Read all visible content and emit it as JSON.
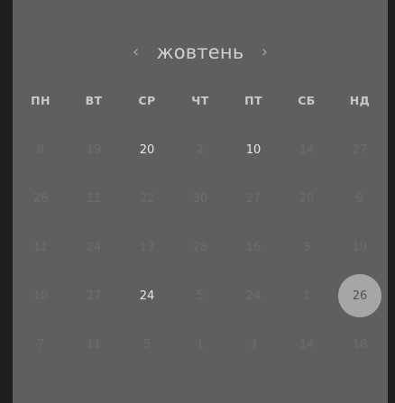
{
  "calendar": {
    "prev_icon": "‹",
    "next_icon": "›",
    "month": "жовтень",
    "weekdays": [
      "ПН",
      "ВТ",
      "СР",
      "ЧТ",
      "ПТ",
      "СБ",
      "НД"
    ],
    "weeks": [
      [
        "8",
        "19",
        "20",
        "2",
        "10",
        "14",
        "27"
      ],
      [
        "26",
        "11",
        "22",
        "30",
        "27",
        "20",
        "9"
      ],
      [
        "11",
        "24",
        "13",
        "28",
        "16",
        "3",
        "19"
      ],
      [
        "10",
        "27",
        "24",
        "5",
        "24",
        "1",
        "26"
      ],
      [
        "7",
        "11",
        "5",
        "1",
        "3",
        "14",
        "18"
      ]
    ],
    "highlighted": [
      [
        0,
        2
      ],
      [
        0,
        4
      ],
      [
        3,
        2
      ]
    ],
    "selected": [
      3,
      6
    ],
    "colors": {
      "panel": "#5f5f5f",
      "background": "#1e1e1e",
      "selected_fill": "#a6a6a6"
    }
  }
}
